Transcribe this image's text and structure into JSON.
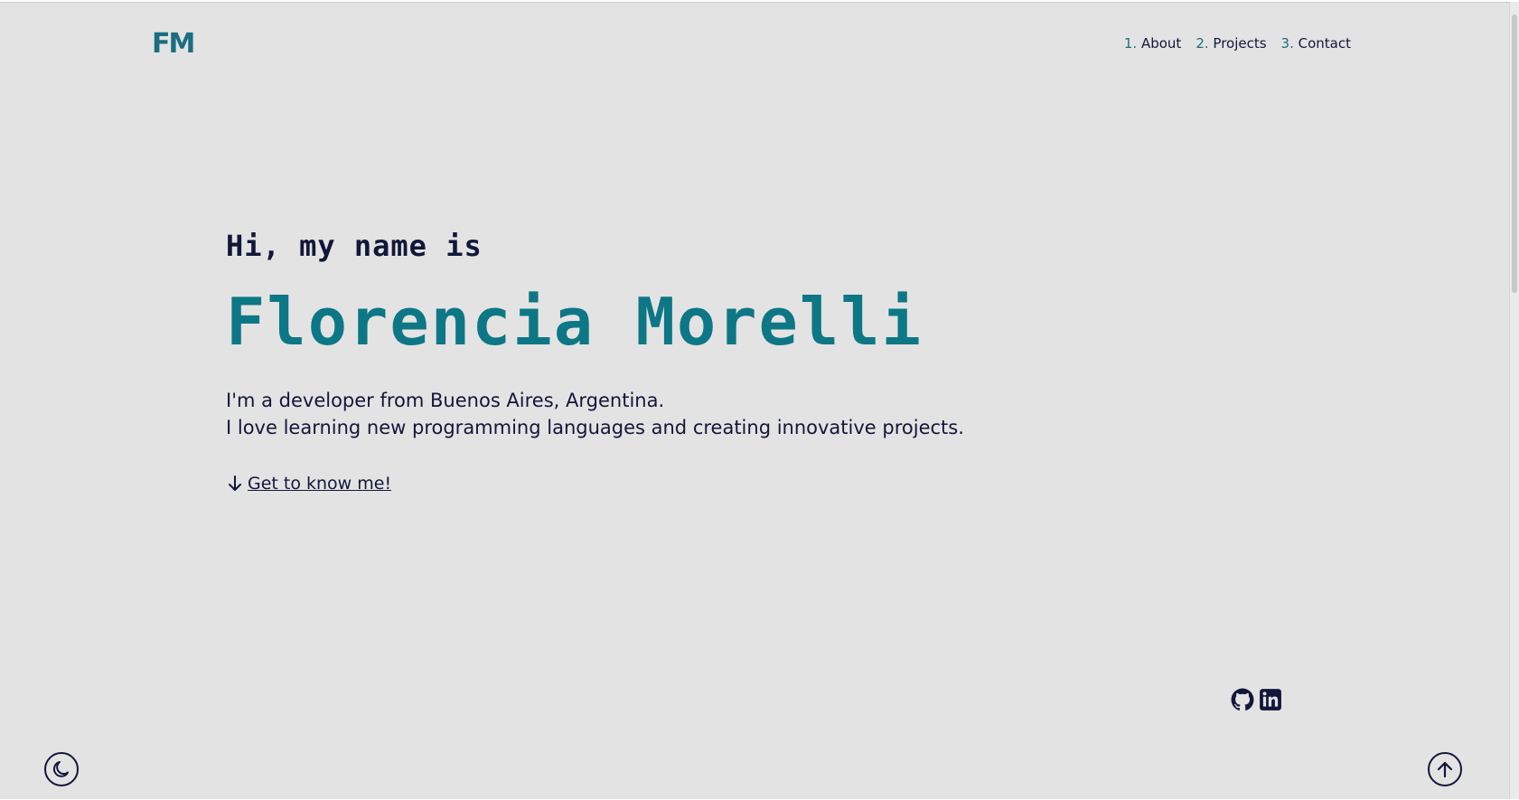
{
  "header": {
    "logo_text": "FM",
    "nav": [
      {
        "num": "1.",
        "label": "About"
      },
      {
        "num": "2.",
        "label": "Projects"
      },
      {
        "num": "3.",
        "label": "Contact"
      }
    ]
  },
  "hero": {
    "greeting": "Hi, my name is",
    "name": "Florencia Morelli",
    "description_line1": "I'm a developer from Buenos Aires, Argentina.",
    "description_line2": "I love learning new programming languages and creating innovative projects.",
    "cta_label": "Get to know me!"
  },
  "socials": [
    {
      "icon": "github-icon"
    },
    {
      "icon": "linkedin-icon"
    }
  ],
  "controls": {
    "theme_toggle_icon": "moon-icon",
    "scroll_top_icon": "arrow-up-icon"
  },
  "colors": {
    "background": "#e3e3e3",
    "text": "#12173a",
    "accent": "#0d7785"
  }
}
